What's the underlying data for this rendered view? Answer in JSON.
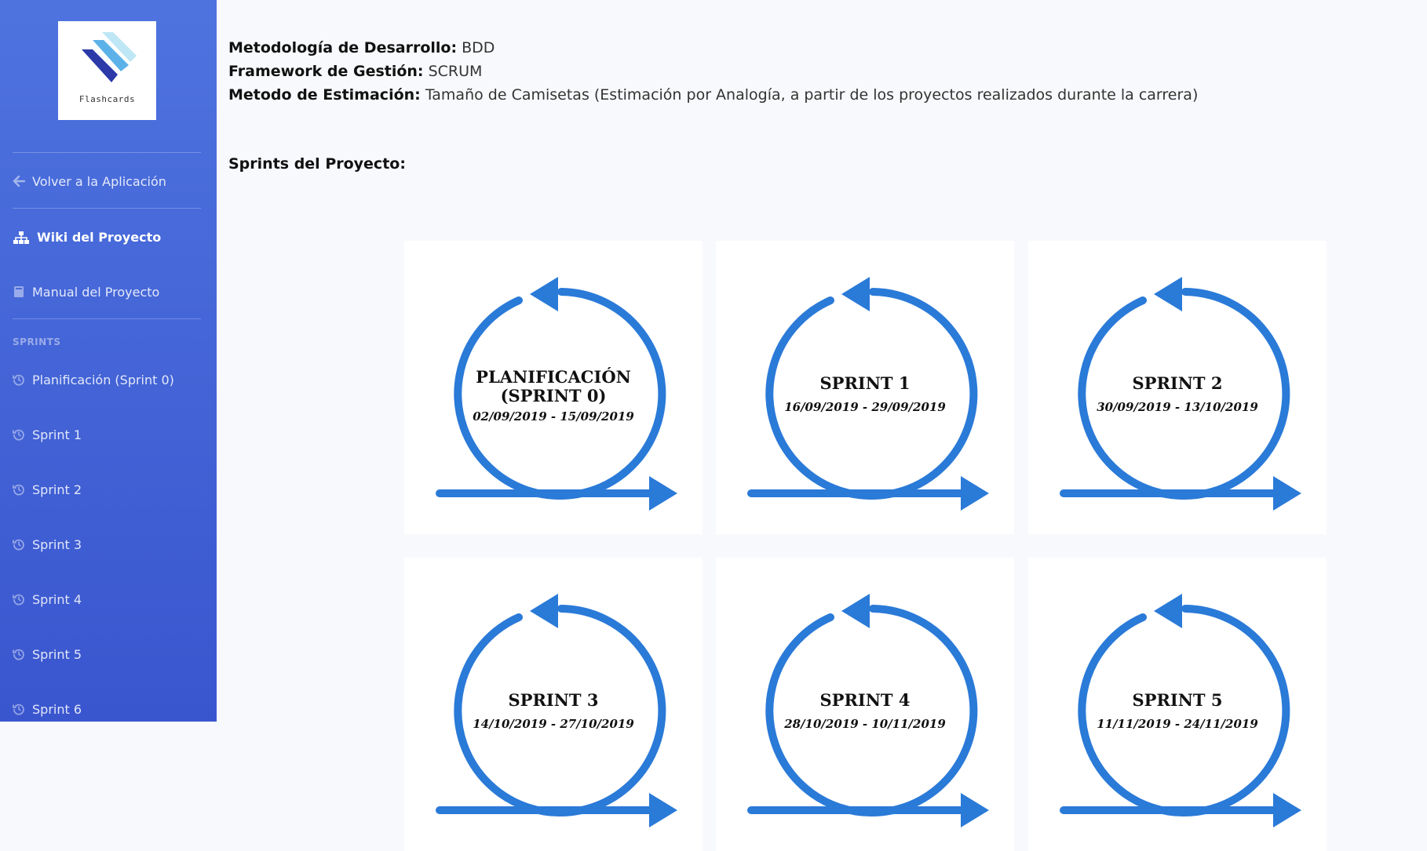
{
  "sidebar": {
    "logo_text": "Flashcards",
    "nav": [
      {
        "label": "Volver a la Aplicación",
        "icon": "arrow-left-icon"
      },
      {
        "label": "Wiki del Proyecto",
        "icon": "sitemap-icon",
        "active": true
      },
      {
        "label": "Manual del Proyecto",
        "icon": "book-icon"
      }
    ],
    "section_heading": "SPRINTS",
    "sprints": [
      {
        "label": "Planificación (Sprint 0)",
        "icon": "history-icon"
      },
      {
        "label": "Sprint 1",
        "icon": "history-icon"
      },
      {
        "label": "Sprint 2",
        "icon": "history-icon"
      },
      {
        "label": "Sprint 3",
        "icon": "history-icon"
      },
      {
        "label": "Sprint 4",
        "icon": "history-icon"
      },
      {
        "label": "Sprint 5",
        "icon": "history-icon"
      },
      {
        "label": "Sprint 6",
        "icon": "history-icon"
      }
    ]
  },
  "main": {
    "meta": [
      {
        "label": "Metodología de Desarrollo:",
        "value": "BDD"
      },
      {
        "label": "Framework de Gestión:",
        "value": "SCRUM"
      },
      {
        "label": "Metodo de Estimación:",
        "value": "Tamaño de Camisetas (Estimación por Analogía, a partir de los proyectos realizados durante la carrera)"
      }
    ],
    "sprints_title": "Sprints del Proyecto:",
    "cards": [
      {
        "name_line1": "PLANIFICACIÓN",
        "name_line2": "(SPRINT 0)",
        "dates": "02/09/2019 - 15/09/2019"
      },
      {
        "name_line1": "SPRINT 1",
        "name_line2": "",
        "dates": "16/09/2019 - 29/09/2019"
      },
      {
        "name_line1": "SPRINT 2",
        "name_line2": "",
        "dates": "30/09/2019 - 13/10/2019"
      },
      {
        "name_line1": "SPRINT 3",
        "name_line2": "",
        "dates": "14/10/2019 - 27/10/2019"
      },
      {
        "name_line1": "SPRINT 4",
        "name_line2": "",
        "dates": "28/10/2019 - 10/11/2019"
      },
      {
        "name_line1": "SPRINT 5",
        "name_line2": "",
        "dates": "11/11/2019 - 24/11/2019"
      }
    ],
    "colors": {
      "accent": "#2a7ad8",
      "sidebar": "#4e73df"
    }
  }
}
